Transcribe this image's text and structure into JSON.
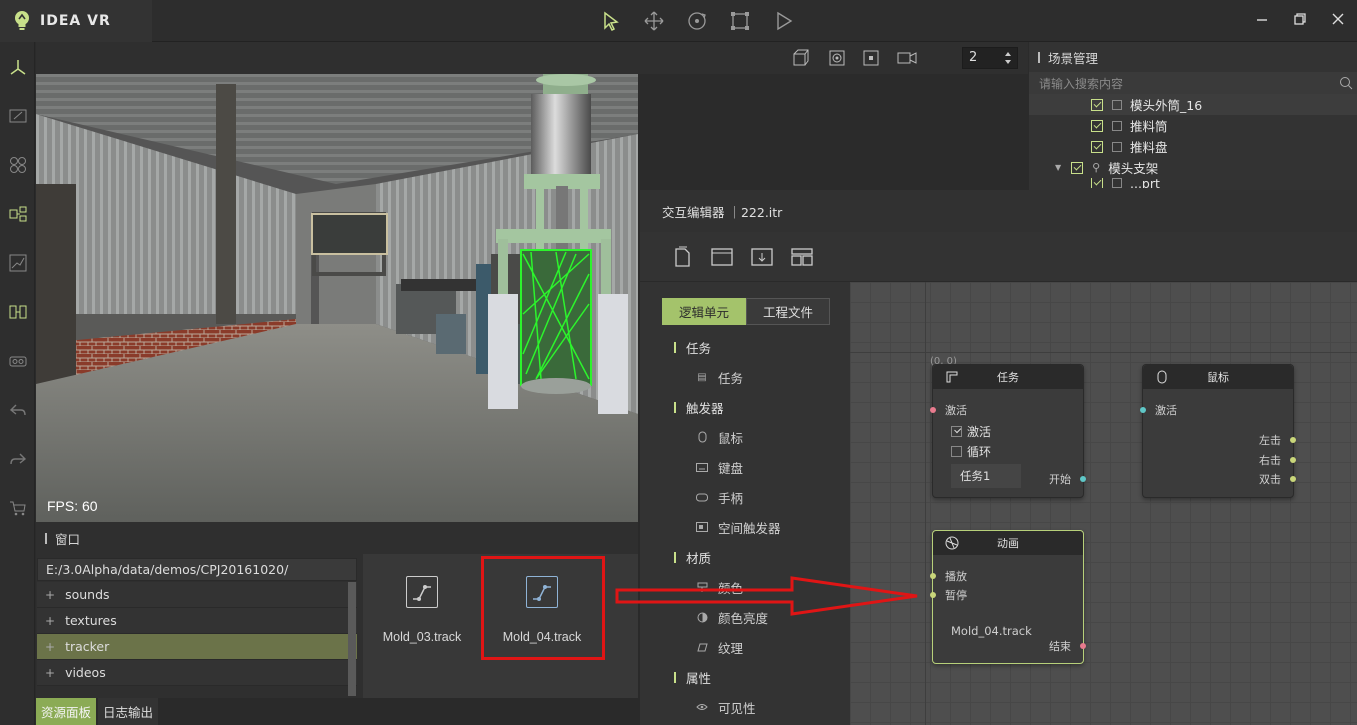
{
  "app": {
    "name": "IDEA VR"
  },
  "viewport": {
    "fps": "FPS: 60",
    "camera_count": "2"
  },
  "scene": {
    "title": "场景管理",
    "search_placeholder": "请输入搜索内容",
    "rows": [
      "模头外筒_16",
      "推料筒",
      "推料盘",
      "模头支架",
      "...prt"
    ]
  },
  "window_panel": {
    "title": "窗口",
    "path": "E:/3.0Alpha/data/demos/CPJ20161020/",
    "folders": [
      "sounds",
      "textures",
      "tracker",
      "videos"
    ],
    "files": [
      "Mold_03.track",
      "Mold_04.track"
    ]
  },
  "bottom_tabs": [
    "资源面板",
    "日志输出"
  ],
  "editor": {
    "title": "交互编辑器 ｜222.itr",
    "tabs": [
      "逻辑单元",
      "工程文件"
    ],
    "categories": [
      {
        "name": "任务",
        "items": [
          "任务"
        ]
      },
      {
        "name": "触发器",
        "items": [
          "鼠标",
          "键盘",
          "手柄",
          "空间触发器"
        ]
      },
      {
        "name": "材质",
        "items": [
          "颜色",
          "颜色亮度",
          "纹理"
        ]
      },
      {
        "name": "属性",
        "items": [
          "可见性"
        ]
      }
    ],
    "nodes": {
      "task": {
        "title": "任务",
        "in": "激活",
        "chk1": "激活",
        "chk2": "循环",
        "input": "任务1",
        "out": "开始"
      },
      "mouse": {
        "title": "鼠标",
        "in": "激活",
        "outs": [
          "左击",
          "右击",
          "双击"
        ]
      },
      "anim": {
        "title": "动画",
        "in1": "播放",
        "in2": "暂停",
        "file": "Mold_04.track",
        "out": "结束"
      }
    },
    "coord_label": "(0, 0)"
  },
  "colors": {
    "accent": "#a4c36b",
    "highlight": "#e01515",
    "port_pink": "#e87b8e",
    "port_teal": "#5fc7c7",
    "port_yellow": "#c9d67a"
  }
}
